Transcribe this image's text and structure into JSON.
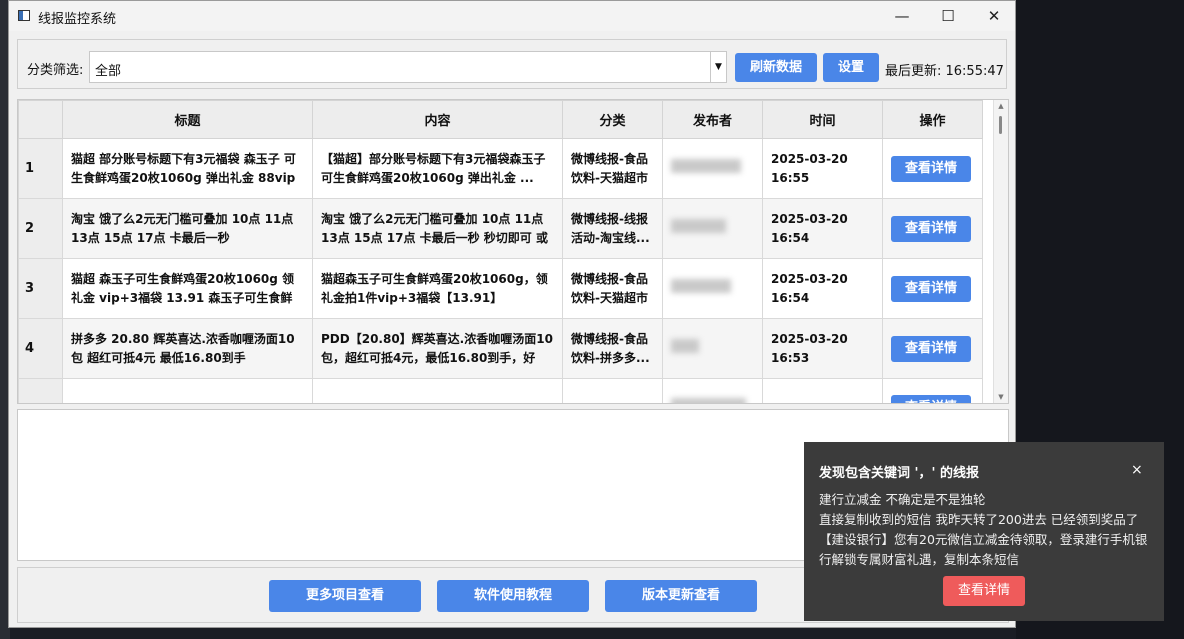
{
  "window": {
    "title": "线报监控系统",
    "minimize_glyph": "—",
    "maximize_glyph": "☐",
    "close_glyph": "✕"
  },
  "toolbar": {
    "filter_label": "分类筛选:",
    "filter_value": "全部",
    "combo_arrow": "▼",
    "refresh_label": "刷新数据",
    "settings_label": "设置",
    "last_update": "最后更新: 16:55:47",
    "accent_color": "#4a86e8"
  },
  "table": {
    "headers": [
      "",
      "标题",
      "内容",
      "分类",
      "发布者",
      "时间",
      "操作"
    ],
    "rows": [
      {
        "num": "1",
        "title": "猫超 部分账号标题下有3元福袋 森玉子 可生食鲜鸡蛋20枚1060g 弹出礼金 88vip",
        "content": "【猫超】部分账号标题下有3元福袋森玉子可生食鲜鸡蛋20枚1060g 弹出礼金 ...",
        "category": "微博线报-食品饮料-天猫超市",
        "time": "2025-03-20 16:55",
        "action": "查看详情"
      },
      {
        "num": "2",
        "title": "淘宝 饿了么2元无门槛可叠加 10点 11点 13点 15点 17点 卡最后一秒",
        "content": "淘宝 饿了么2元无门槛可叠加 10点 11点 13点 15点 17点 卡最后一秒 秒切即可 或淘...",
        "category": "微博线报-线报活动-淘宝线...",
        "time": "2025-03-20 16:54",
        "action": "查看详情"
      },
      {
        "num": "3",
        "title": "猫超 森玉子可生食鲜鸡蛋20枚1060g 领礼金 vip+3福袋 13.91 森玉子可生食鲜鸡...",
        "content": "猫超森玉子可生食鲜鸡蛋20枚1060g，领礼金拍1件vip+3福袋【13.91】",
        "category": "微博线报-食品饮料-天猫超市",
        "time": "2025-03-20 16:54",
        "action": "查看详情"
      },
      {
        "num": "4",
        "title": "拼多多 20.80 辉英喜达.浓香咖喱汤面10包 超红可抵4元 最低16.80到手",
        "content": "PDD【20.80】辉英喜达.浓香咖喱汤面10包，超红可抵4元，最低16.80到手，好吃...",
        "category": "微博线报-食品饮料-拼多多...",
        "time": "2025-03-20 16:53",
        "action": "查看详情"
      },
      {
        "num": "",
        "title": "",
        "content": "",
        "category": "",
        "time": "",
        "action": "查看详情"
      }
    ]
  },
  "footer": {
    "more_projects_label": "更多项目查看",
    "tutorial_label": "软件使用教程",
    "version_label": "版本更新查看"
  },
  "notification": {
    "title": "发现包含关键词 '，' 的线报",
    "close_glyph": "×",
    "body": "建行立减金 不确定是不是独轮\n直接复制收到的短信 我昨天转了200进去 已经领到奖品了【建设银行】您有20元微信立减金待领取，登录建行手机银行解锁专属财富礼遇，复制本条短信",
    "button_label": "查看详情",
    "button_color": "#ef5b5b"
  }
}
